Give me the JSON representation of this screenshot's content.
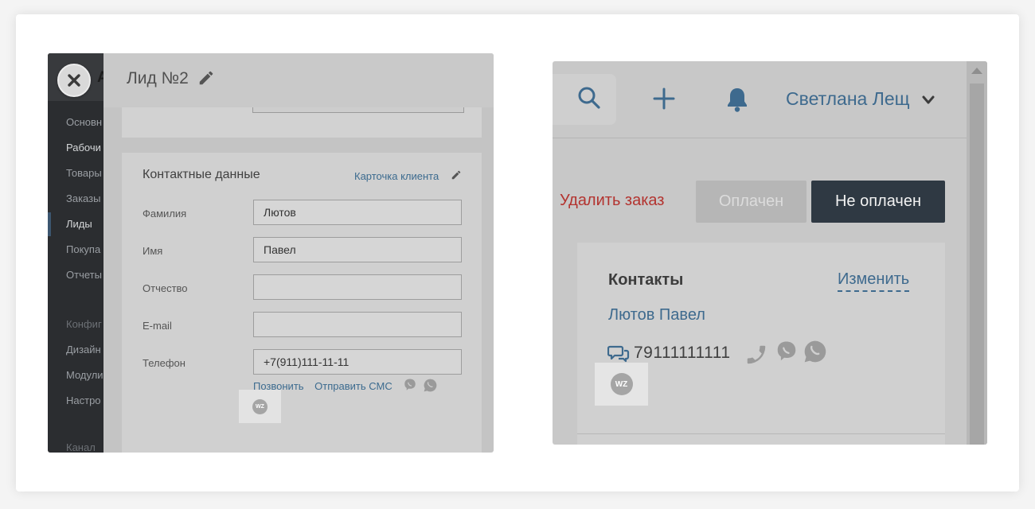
{
  "left_panel": {
    "sidebar": {
      "peek_letter": "А",
      "items": [
        {
          "label": "Основн",
          "tone": "dim"
        },
        {
          "label": "Рабочи",
          "tone": "bright"
        },
        {
          "label": "Товары",
          "tone": "dim"
        },
        {
          "label": "Заказы",
          "tone": "dim"
        },
        {
          "label": "Лиды",
          "tone": "bright",
          "active": true
        },
        {
          "label": "Покупа",
          "tone": "dim"
        },
        {
          "label": "Отчеты",
          "tone": "dim"
        },
        {
          "label": "Конфиг",
          "tone": "muted"
        },
        {
          "label": "Дизайн",
          "tone": "dim"
        },
        {
          "label": "Модули",
          "tone": "dim"
        },
        {
          "label": "Настро",
          "tone": "dim"
        },
        {
          "label": "Канал",
          "tone": "muted"
        }
      ]
    },
    "close_icon": "close-x-icon",
    "lead_title": "Лид №2",
    "edit_icon": "pencil-icon",
    "contact_section": {
      "title": "Контактные данные",
      "client_card_link": "Карточка клиента",
      "fields": [
        {
          "label": "Фамилия",
          "value": "Лютов"
        },
        {
          "label": "Имя",
          "value": "Павел"
        },
        {
          "label": "Отчество",
          "value": ""
        },
        {
          "label": "E-mail",
          "value": ""
        },
        {
          "label": "Телефон",
          "value": "+7(911)111-11-11"
        }
      ],
      "call_link": "Позвонить",
      "sms_link": "Отправить СМС",
      "messenger_icons": [
        "viber-icon",
        "whatsapp-icon"
      ]
    },
    "badge_text": "WZ"
  },
  "right_panel": {
    "topbar": {
      "icons": [
        "search-icon",
        "plus-icon",
        "bell-icon",
        "chevron-down-icon"
      ],
      "user_name": "Светлана Лещ"
    },
    "order_actions": {
      "delete_link": "Удалить заказ",
      "paid_button": "Оплачен",
      "unpaid_button": "Не оплачен"
    },
    "contacts": {
      "title": "Контакты",
      "change_link": "Изменить",
      "client_name": "Лютов Павел",
      "phone": "79111111111",
      "icons": [
        "chat-icon",
        "phone-icon",
        "viber-icon",
        "whatsapp-icon"
      ]
    },
    "badge_text": "WZ"
  },
  "colors": {
    "link_blue": "#3e6a8e",
    "danger_red": "#b3332f",
    "dark_button": "#2f3943",
    "overlay_gray": "#c4c4c4"
  }
}
